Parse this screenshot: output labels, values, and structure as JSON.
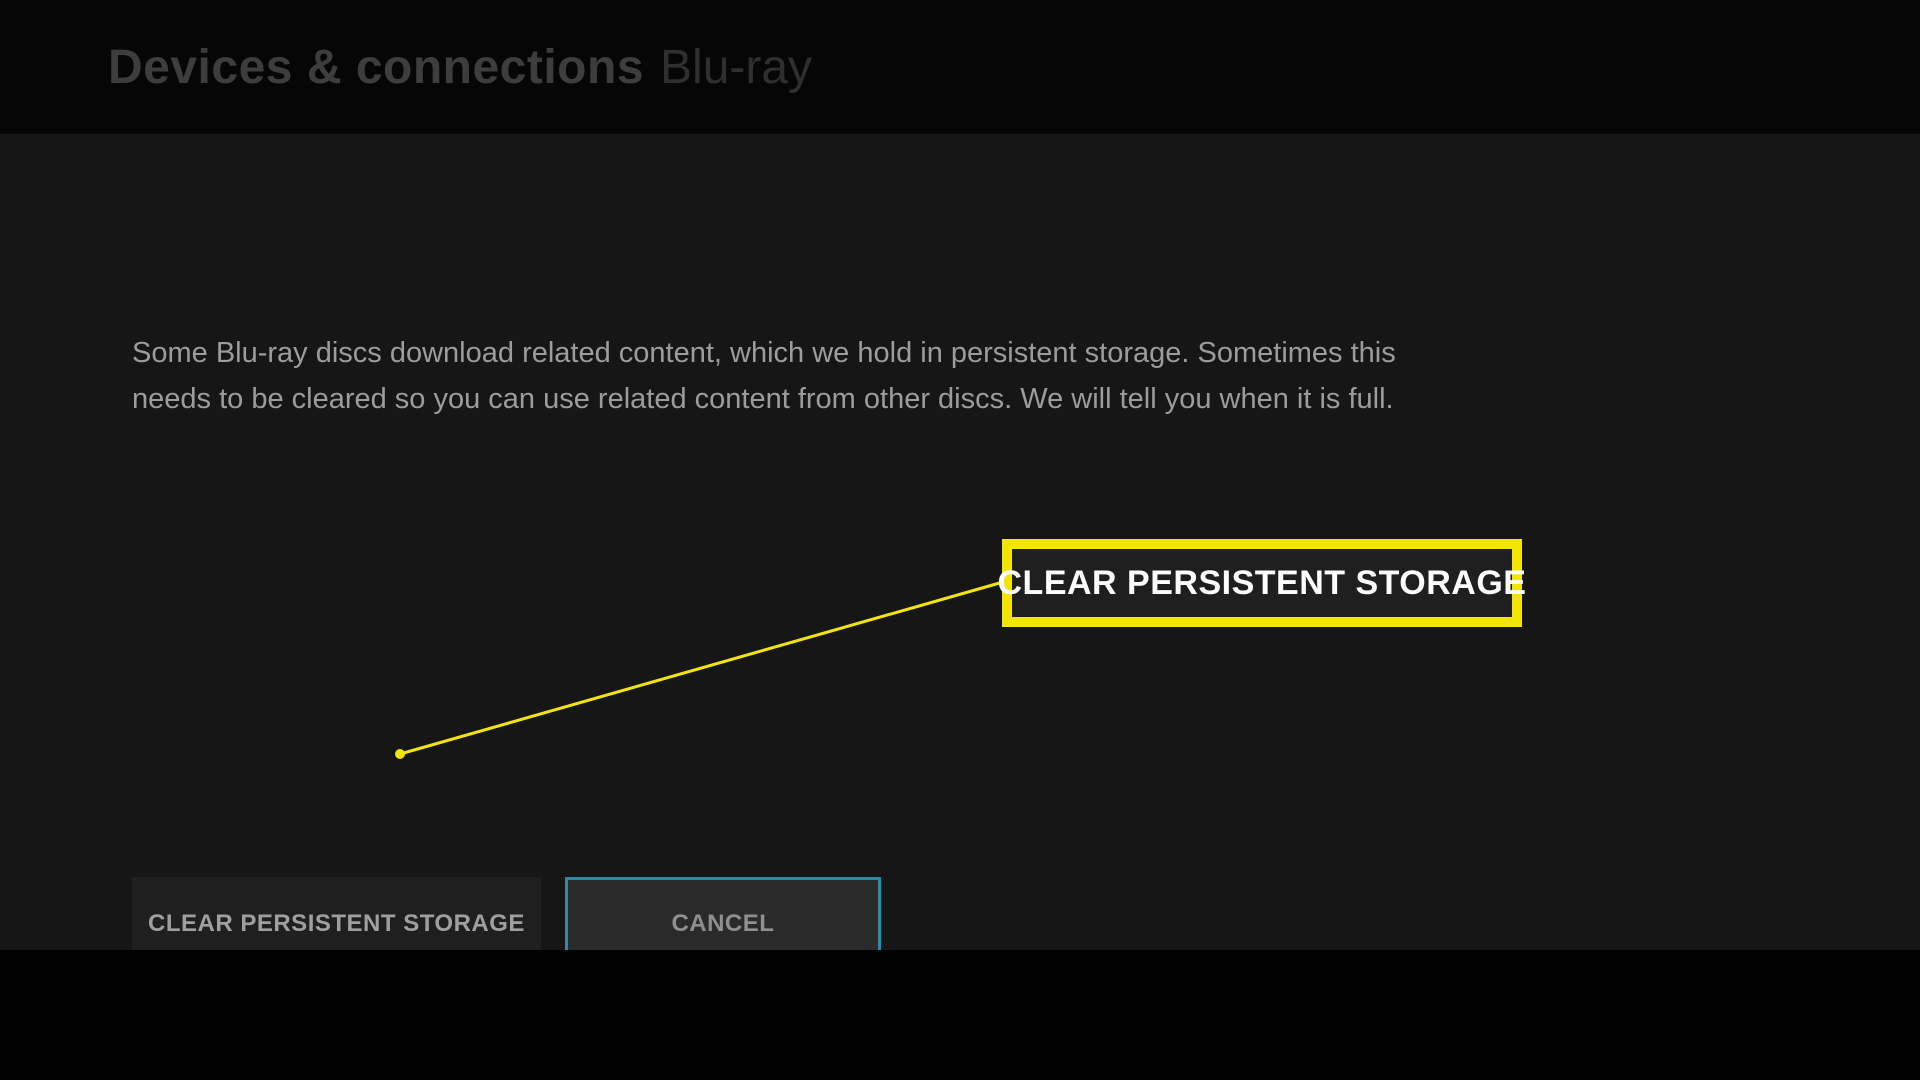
{
  "header": {
    "title": "Devices & connections",
    "subtitle": "Blu-ray"
  },
  "description": "Some Blu-ray discs download related content, which we hold in persistent storage.  Sometimes this needs to be cleared so you can use related content from other discs. We will tell you when it is full.",
  "buttons": {
    "clear_label": "CLEAR PERSISTENT STORAGE",
    "cancel_label": "CANCEL"
  },
  "callout": {
    "label": "CLEAR PERSISTENT STORAGE"
  },
  "colors": {
    "highlight": "#f2e600",
    "focus_border": "#2f89a8",
    "bg_content": "#161616",
    "bg_button": "#1f1f1f",
    "bg_button_focused": "#2a2a2a"
  }
}
